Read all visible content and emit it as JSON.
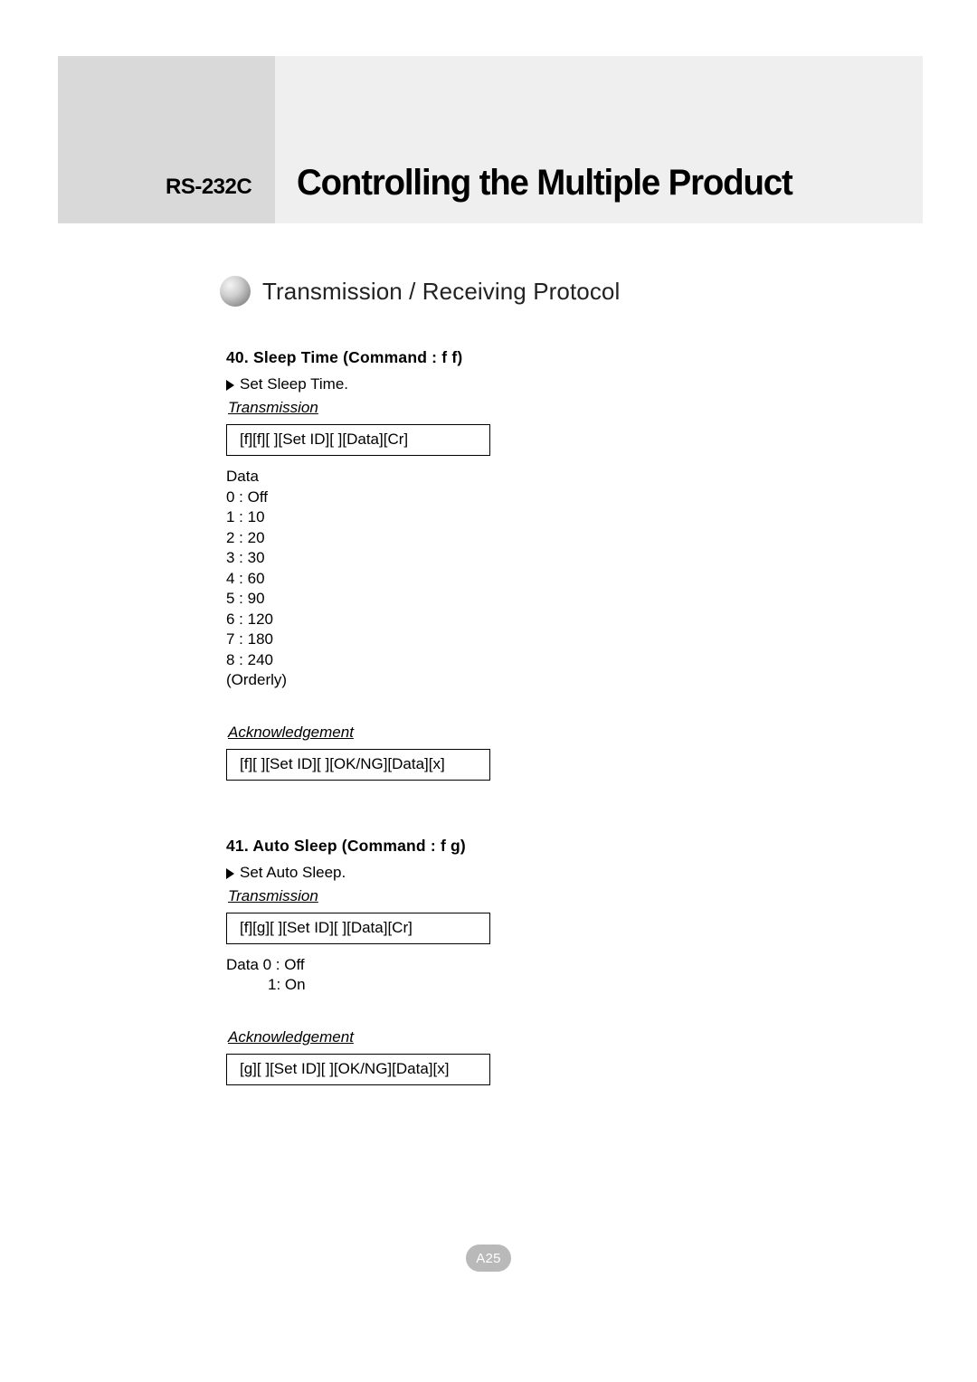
{
  "header": {
    "left_label": "RS-232C",
    "title": "Controlling the Multiple Product"
  },
  "section": {
    "heading": "Transmission / Receiving Protocol"
  },
  "commands": [
    {
      "title": "40. Sleep Time (Command : f f)",
      "subtitle": "Set Sleep Time.",
      "transmission_label": "Transmission",
      "transmission_code": "[f][f][ ][Set ID][ ][Data][Cr]",
      "data_label": "Data",
      "data_values": [
        "0 : Off",
        "1 : 10",
        "2 : 20",
        "3 : 30",
        "4 : 60",
        "5 : 90",
        "6 : 120",
        "7 : 180",
        "8 : 240",
        "(Orderly)"
      ],
      "ack_label": "Acknowledgement",
      "ack_code": "[f][ ][Set ID][ ][OK/NG][Data][x]"
    },
    {
      "title": "41. Auto Sleep (Command : f g)",
      "subtitle": "Set Auto Sleep.",
      "transmission_label": "Transmission",
      "transmission_code": "[f][g][ ][Set ID][ ][Data][Cr]",
      "data_line_1": "Data 0 : Off",
      "data_line_2": "1: On",
      "ack_label": "Acknowledgement",
      "ack_code": "[g][ ][Set ID][ ][OK/NG][Data][x]"
    }
  ],
  "footer": {
    "page": "A25"
  }
}
